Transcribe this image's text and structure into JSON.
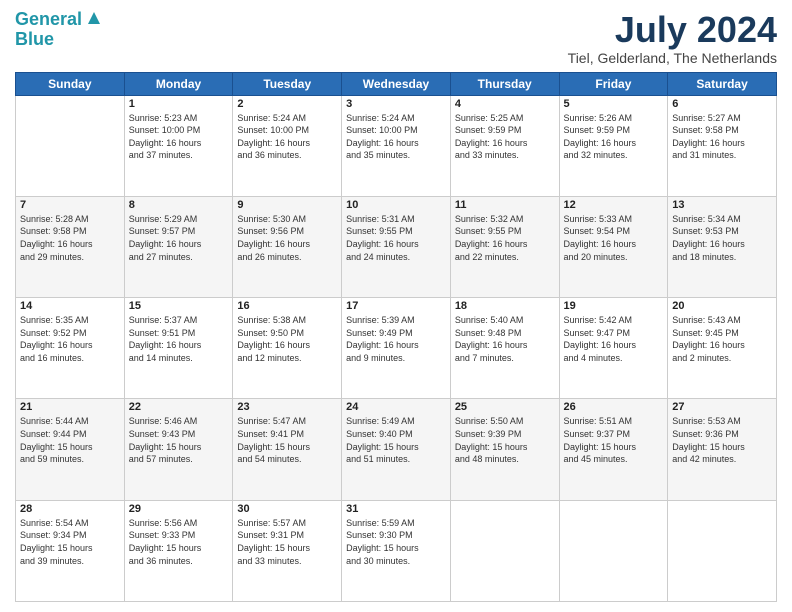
{
  "header": {
    "logo_line1": "General",
    "logo_line2": "Blue",
    "month": "July 2024",
    "location": "Tiel, Gelderland, The Netherlands"
  },
  "days_of_week": [
    "Sunday",
    "Monday",
    "Tuesday",
    "Wednesday",
    "Thursday",
    "Friday",
    "Saturday"
  ],
  "weeks": [
    [
      {
        "day": "",
        "info": ""
      },
      {
        "day": "1",
        "info": "Sunrise: 5:23 AM\nSunset: 10:00 PM\nDaylight: 16 hours\nand 37 minutes."
      },
      {
        "day": "2",
        "info": "Sunrise: 5:24 AM\nSunset: 10:00 PM\nDaylight: 16 hours\nand 36 minutes."
      },
      {
        "day": "3",
        "info": "Sunrise: 5:24 AM\nSunset: 10:00 PM\nDaylight: 16 hours\nand 35 minutes."
      },
      {
        "day": "4",
        "info": "Sunrise: 5:25 AM\nSunset: 9:59 PM\nDaylight: 16 hours\nand 33 minutes."
      },
      {
        "day": "5",
        "info": "Sunrise: 5:26 AM\nSunset: 9:59 PM\nDaylight: 16 hours\nand 32 minutes."
      },
      {
        "day": "6",
        "info": "Sunrise: 5:27 AM\nSunset: 9:58 PM\nDaylight: 16 hours\nand 31 minutes."
      }
    ],
    [
      {
        "day": "7",
        "info": "Sunrise: 5:28 AM\nSunset: 9:58 PM\nDaylight: 16 hours\nand 29 minutes."
      },
      {
        "day": "8",
        "info": "Sunrise: 5:29 AM\nSunset: 9:57 PM\nDaylight: 16 hours\nand 27 minutes."
      },
      {
        "day": "9",
        "info": "Sunrise: 5:30 AM\nSunset: 9:56 PM\nDaylight: 16 hours\nand 26 minutes."
      },
      {
        "day": "10",
        "info": "Sunrise: 5:31 AM\nSunset: 9:55 PM\nDaylight: 16 hours\nand 24 minutes."
      },
      {
        "day": "11",
        "info": "Sunrise: 5:32 AM\nSunset: 9:55 PM\nDaylight: 16 hours\nand 22 minutes."
      },
      {
        "day": "12",
        "info": "Sunrise: 5:33 AM\nSunset: 9:54 PM\nDaylight: 16 hours\nand 20 minutes."
      },
      {
        "day": "13",
        "info": "Sunrise: 5:34 AM\nSunset: 9:53 PM\nDaylight: 16 hours\nand 18 minutes."
      }
    ],
    [
      {
        "day": "14",
        "info": "Sunrise: 5:35 AM\nSunset: 9:52 PM\nDaylight: 16 hours\nand 16 minutes."
      },
      {
        "day": "15",
        "info": "Sunrise: 5:37 AM\nSunset: 9:51 PM\nDaylight: 16 hours\nand 14 minutes."
      },
      {
        "day": "16",
        "info": "Sunrise: 5:38 AM\nSunset: 9:50 PM\nDaylight: 16 hours\nand 12 minutes."
      },
      {
        "day": "17",
        "info": "Sunrise: 5:39 AM\nSunset: 9:49 PM\nDaylight: 16 hours\nand 9 minutes."
      },
      {
        "day": "18",
        "info": "Sunrise: 5:40 AM\nSunset: 9:48 PM\nDaylight: 16 hours\nand 7 minutes."
      },
      {
        "day": "19",
        "info": "Sunrise: 5:42 AM\nSunset: 9:47 PM\nDaylight: 16 hours\nand 4 minutes."
      },
      {
        "day": "20",
        "info": "Sunrise: 5:43 AM\nSunset: 9:45 PM\nDaylight: 16 hours\nand 2 minutes."
      }
    ],
    [
      {
        "day": "21",
        "info": "Sunrise: 5:44 AM\nSunset: 9:44 PM\nDaylight: 15 hours\nand 59 minutes."
      },
      {
        "day": "22",
        "info": "Sunrise: 5:46 AM\nSunset: 9:43 PM\nDaylight: 15 hours\nand 57 minutes."
      },
      {
        "day": "23",
        "info": "Sunrise: 5:47 AM\nSunset: 9:41 PM\nDaylight: 15 hours\nand 54 minutes."
      },
      {
        "day": "24",
        "info": "Sunrise: 5:49 AM\nSunset: 9:40 PM\nDaylight: 15 hours\nand 51 minutes."
      },
      {
        "day": "25",
        "info": "Sunrise: 5:50 AM\nSunset: 9:39 PM\nDaylight: 15 hours\nand 48 minutes."
      },
      {
        "day": "26",
        "info": "Sunrise: 5:51 AM\nSunset: 9:37 PM\nDaylight: 15 hours\nand 45 minutes."
      },
      {
        "day": "27",
        "info": "Sunrise: 5:53 AM\nSunset: 9:36 PM\nDaylight: 15 hours\nand 42 minutes."
      }
    ],
    [
      {
        "day": "28",
        "info": "Sunrise: 5:54 AM\nSunset: 9:34 PM\nDaylight: 15 hours\nand 39 minutes."
      },
      {
        "day": "29",
        "info": "Sunrise: 5:56 AM\nSunset: 9:33 PM\nDaylight: 15 hours\nand 36 minutes."
      },
      {
        "day": "30",
        "info": "Sunrise: 5:57 AM\nSunset: 9:31 PM\nDaylight: 15 hours\nand 33 minutes."
      },
      {
        "day": "31",
        "info": "Sunrise: 5:59 AM\nSunset: 9:30 PM\nDaylight: 15 hours\nand 30 minutes."
      },
      {
        "day": "",
        "info": ""
      },
      {
        "day": "",
        "info": ""
      },
      {
        "day": "",
        "info": ""
      }
    ]
  ]
}
